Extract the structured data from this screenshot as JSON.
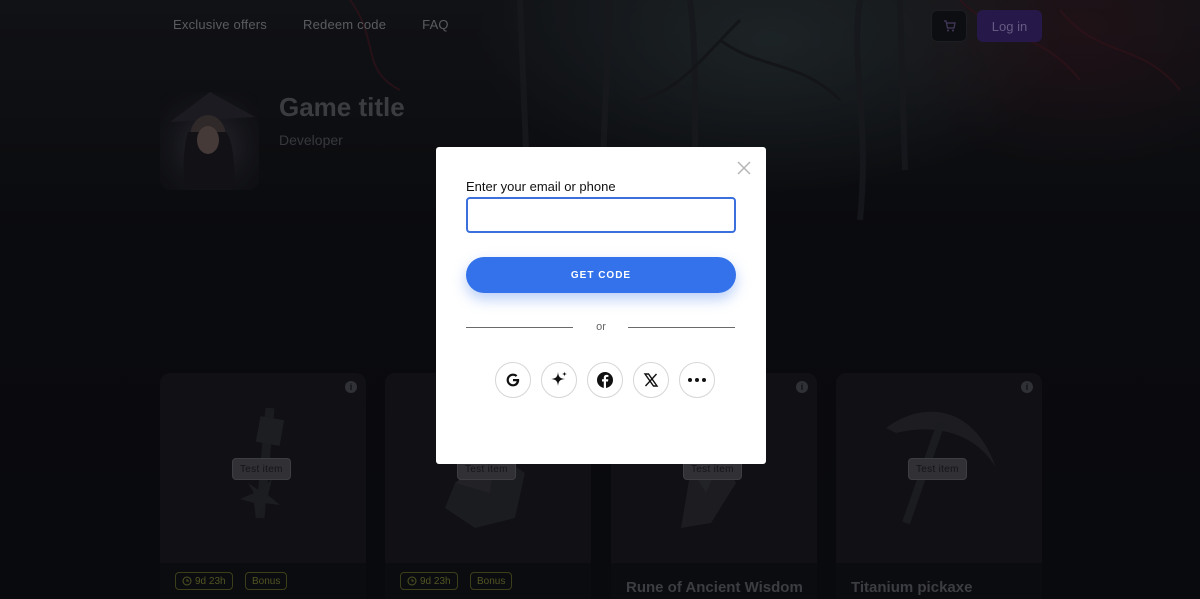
{
  "nav": {
    "items": [
      "Exclusive offers",
      "Redeem code",
      "FAQ"
    ],
    "login_label": "Log in"
  },
  "game": {
    "title": "Game title",
    "developer": "Developer"
  },
  "cards": [
    {
      "badge": "Test item",
      "timer": "9d 23h",
      "bonus": "Bonus",
      "name": ""
    },
    {
      "badge": "Test item",
      "timer": "9d 23h",
      "bonus": "Bonus",
      "name": ""
    },
    {
      "badge": "Test item",
      "timer": "",
      "bonus": "",
      "name": "Rune of Ancient Wisdom"
    },
    {
      "badge": "Test item",
      "timer": "",
      "bonus": "",
      "name": "Titanium pickaxe"
    }
  ],
  "modal": {
    "field_label": "Enter your email or phone",
    "email_value": "",
    "email_placeholder": "",
    "get_code_label": "GET CODE",
    "divider_text": "or",
    "socials": [
      "google-icon",
      "sparkle-icon",
      "facebook-icon",
      "x-icon",
      "more-icon"
    ]
  },
  "colors": {
    "primary_button": "#3372ea",
    "login_button": "#3b2570",
    "tag_olive": "#7d8237"
  }
}
